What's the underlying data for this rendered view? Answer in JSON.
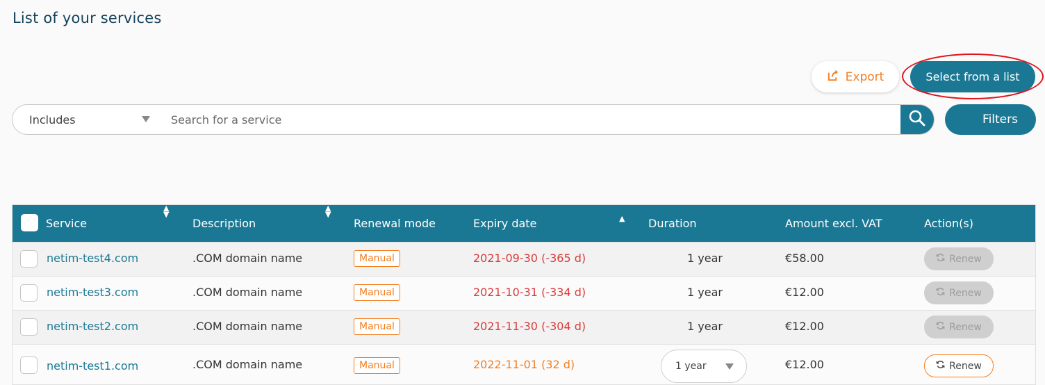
{
  "page": {
    "title": "List of your services"
  },
  "toolbar": {
    "export_label": "Export",
    "select_label": "Select from a list",
    "filters_label": "Filters"
  },
  "search": {
    "mode": "Includes",
    "placeholder": "Search for a service"
  },
  "table": {
    "headers": {
      "service": "Service",
      "description": "Description",
      "renewal_mode": "Renewal mode",
      "expiry_date": "Expiry date",
      "duration": "Duration",
      "amount": "Amount excl. VAT",
      "actions": "Action(s)"
    },
    "rows": [
      {
        "service": "netim-test4.com",
        "description": ".COM domain name",
        "renewal_mode": "Manual",
        "expiry": "2021-09-30 (-365 d)",
        "duration": "1 year",
        "amount": "€58.00",
        "action": "Renew"
      },
      {
        "service": "netim-test3.com",
        "description": ".COM domain name",
        "renewal_mode": "Manual",
        "expiry": "2021-10-31 (-334 d)",
        "duration": "1 year",
        "amount": "€12.00",
        "action": "Renew"
      },
      {
        "service": "netim-test2.com",
        "description": ".COM domain name",
        "renewal_mode": "Manual",
        "expiry": "2021-11-30 (-304 d)",
        "duration": "1 year",
        "amount": "€12.00",
        "action": "Renew"
      },
      {
        "service": "netim-test1.com",
        "description": ".COM domain name",
        "renewal_mode": "Manual",
        "expiry": "2022-11-01 (32 d)",
        "duration": "1 year",
        "amount": "€12.00",
        "action": "Renew"
      }
    ]
  },
  "colors": {
    "primary": "#1b7894",
    "accent": "#f47e20",
    "danger": "#d93a3a",
    "highlight": "#e0141b"
  }
}
